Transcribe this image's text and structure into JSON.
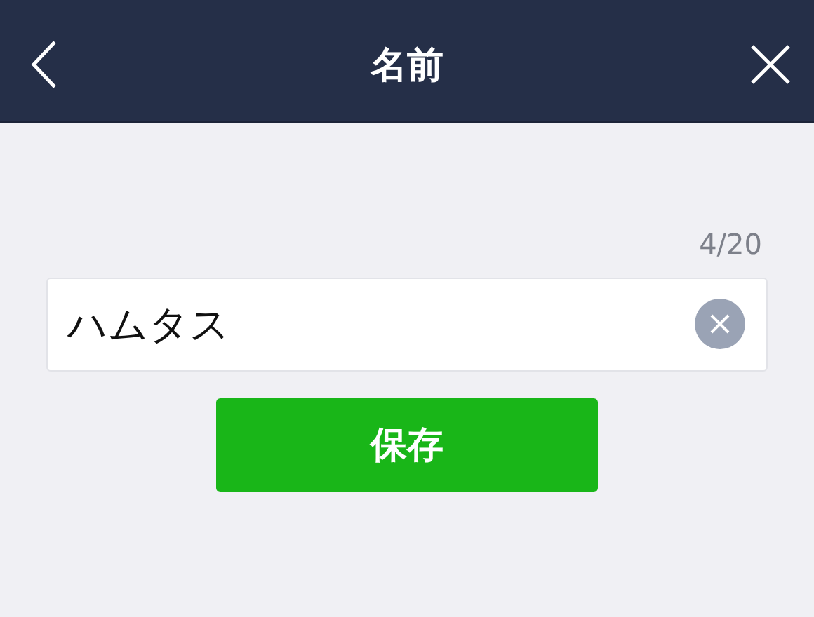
{
  "header": {
    "title": "名前"
  },
  "name_field": {
    "value": "ハムタス",
    "counter": "4/20"
  },
  "save_button": {
    "label": "保存"
  }
}
